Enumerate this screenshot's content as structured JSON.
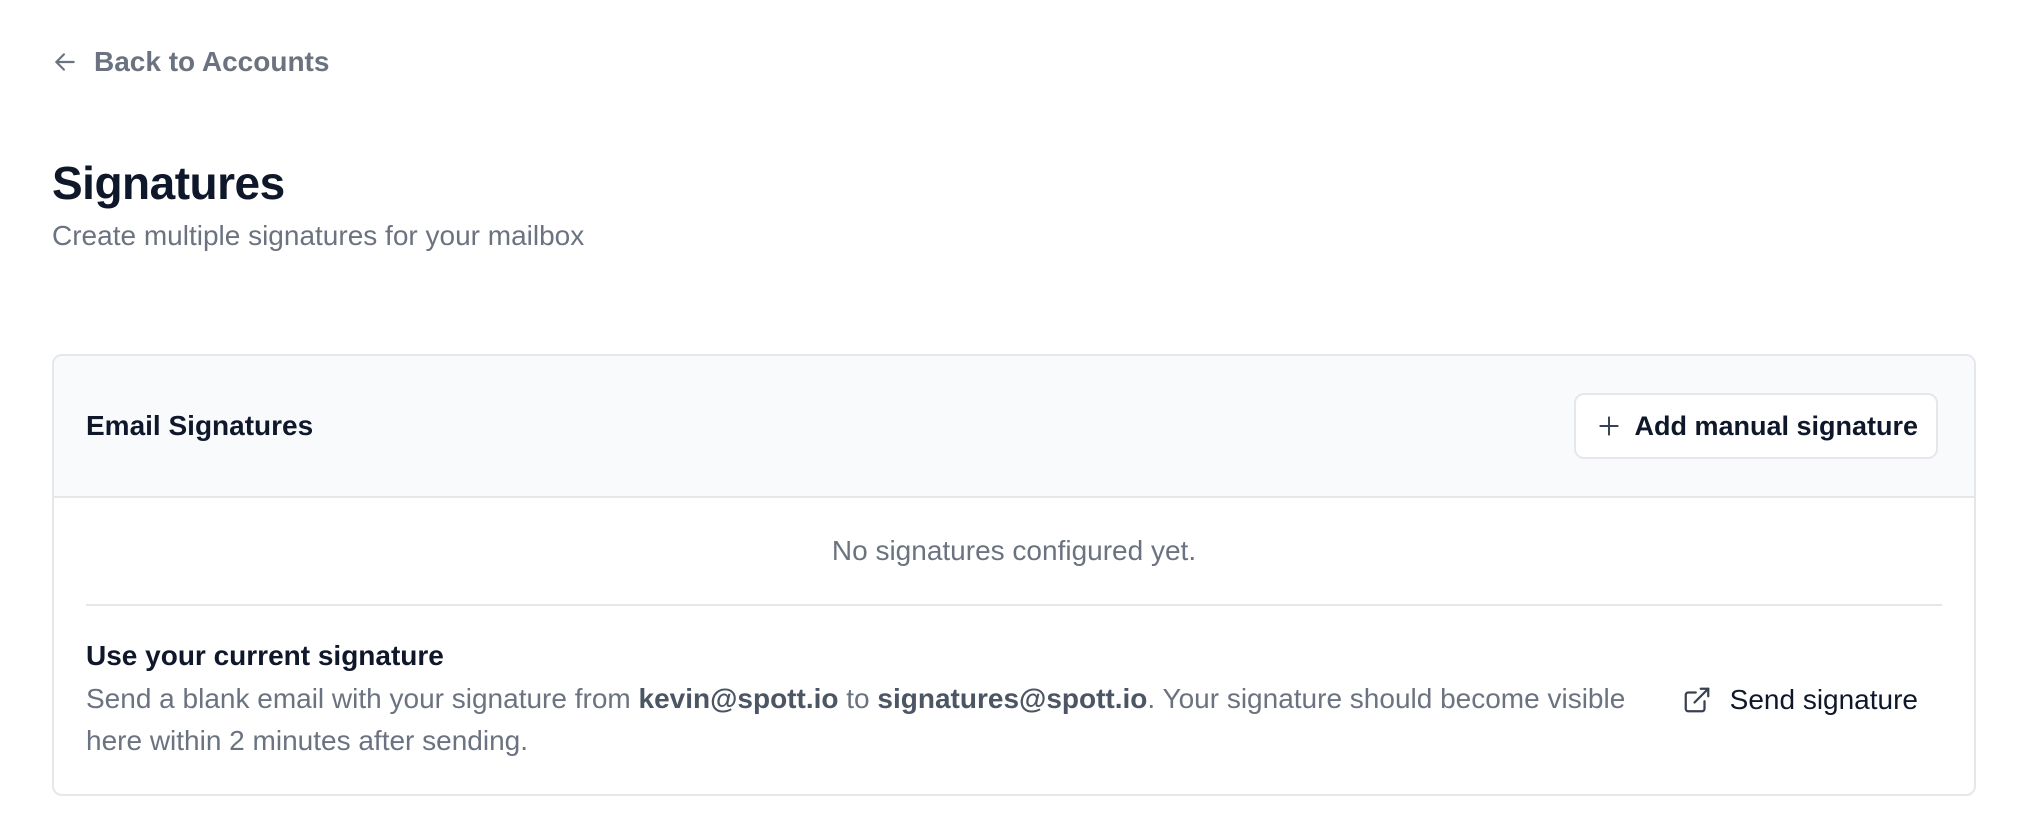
{
  "nav": {
    "back_label": "Back to Accounts",
    "back_icon": "arrow-left-icon"
  },
  "page": {
    "title": "Signatures",
    "subtitle": "Create multiple signatures for your mailbox"
  },
  "card": {
    "title": "Email Signatures",
    "add_button": {
      "label": "Add manual signature",
      "icon": "plus-icon"
    },
    "empty_state": "No signatures configured yet.",
    "current_signature": {
      "title": "Use your current signature",
      "desc_part1": "Send a blank email with your signature from ",
      "from_email": "kevin@spott.io",
      "desc_part2": " to ",
      "to_email": "signatures@spott.io",
      "desc_part3": ". Your signature should become visible here within 2 minutes after sending.",
      "send_button": {
        "label": "Send signature",
        "icon": "external-link-icon"
      }
    }
  },
  "colors": {
    "text_primary": "#0f172a",
    "text_muted": "#6b7280",
    "border": "#e5e7eb",
    "header_bg": "#f8fafc"
  }
}
